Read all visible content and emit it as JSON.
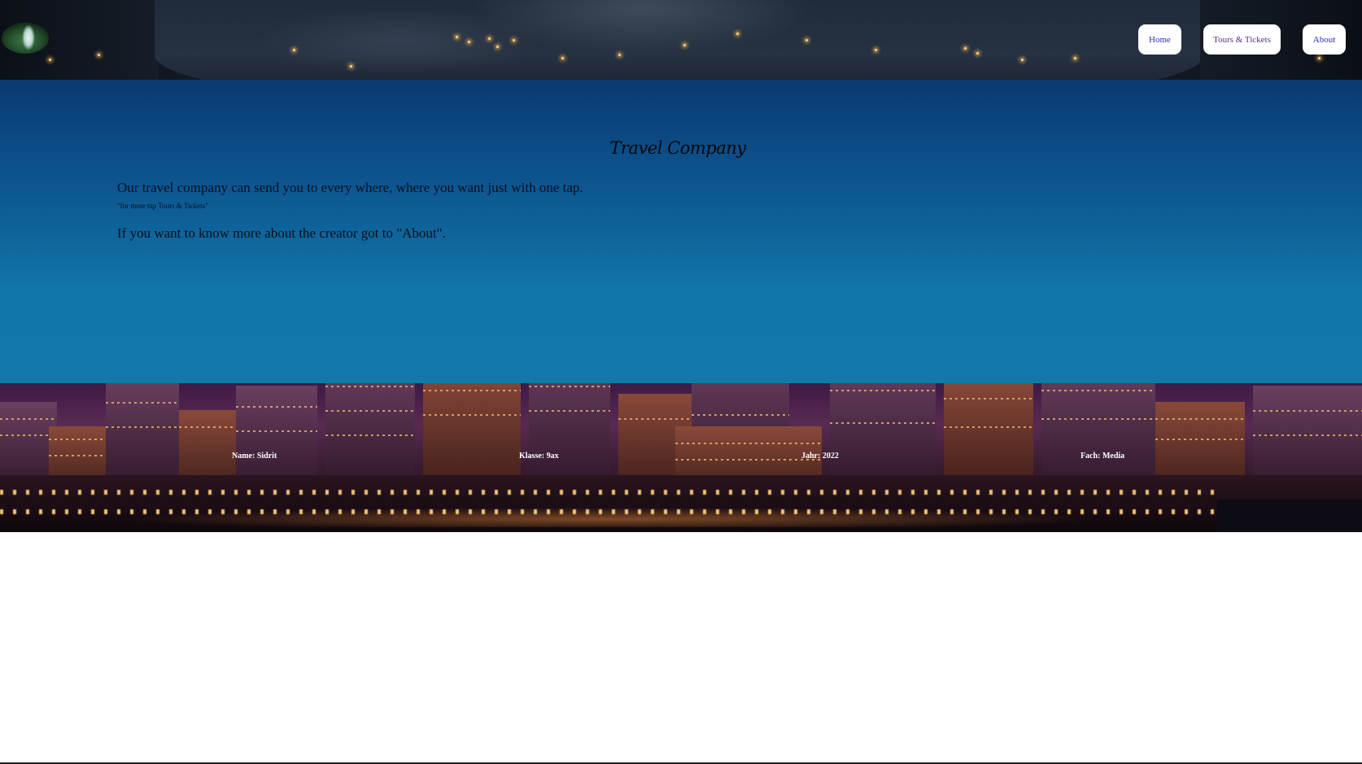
{
  "header": {
    "logo_icon": "waterfall-logo",
    "nav": {
      "home_label": "Home",
      "tours_label": "Tours & Tickets",
      "about_label": "About"
    }
  },
  "main": {
    "title": "Travel Company",
    "line1": "Our travel company can send you to every where, where you want just with one tap.",
    "hint": "\"for more tap Tours & Tickets\"",
    "line2": "If you want to know more about the creator got to \"About\"."
  },
  "footer": {
    "name": "Name: Sidrit",
    "klasse": "Klasse: 9ax",
    "jahr": "Jahr: 2022",
    "fach": "Fach: Media"
  },
  "colors": {
    "nav_link": "#2a2ac8",
    "main_gradient_top": "#0a3a72",
    "main_gradient_bottom": "#1278aa",
    "footer_text": "#ffffff"
  }
}
